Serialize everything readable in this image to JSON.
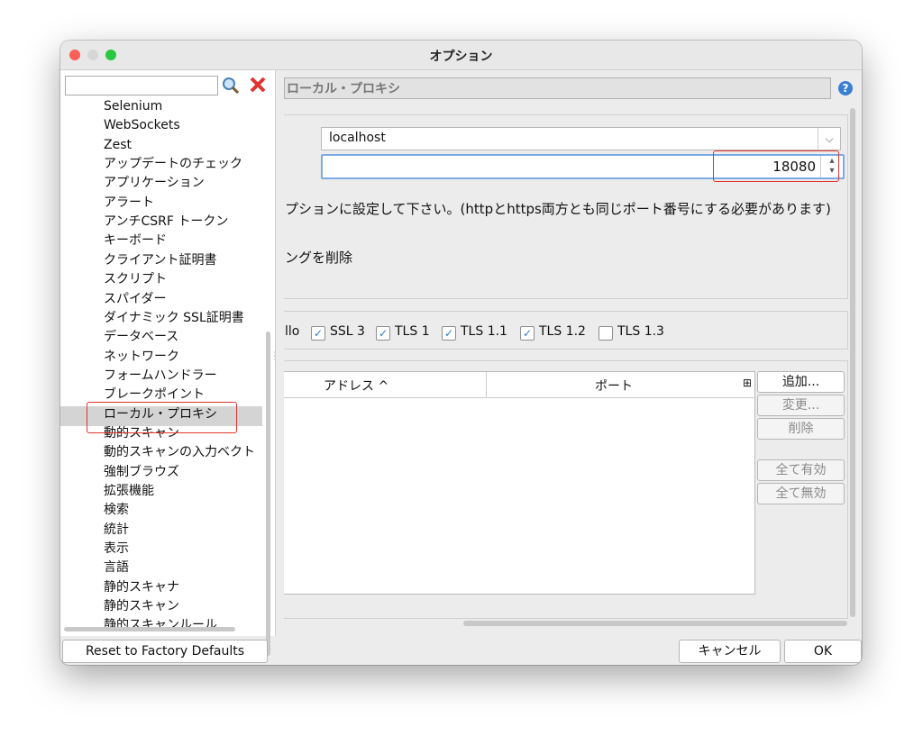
{
  "window": {
    "title": "オプション"
  },
  "tree": {
    "search_value": "",
    "items": [
      "Selenium",
      "WebSockets",
      "Zest",
      "アップデートのチェック",
      "アプリケーション",
      "アラート",
      "アンチCSRF トークン",
      "キーボード",
      "クライアント証明書",
      "スクリプト",
      "スパイダー",
      "ダイナミック SSL証明書",
      "データベース",
      "ネットワーク",
      "フォームハンドラー",
      "ブレークポイント",
      "ローカル・プロキシ",
      "動的スキャン",
      "動的スキャンの入力ベクト",
      "強制ブラウズ",
      "拡張機能",
      "検索",
      "統計",
      "表示",
      "言語",
      "静的スキャナ",
      "静的スキャン",
      "静的スキャンルール"
    ],
    "selected": "ローカル・プロキシ"
  },
  "panel": {
    "header": "ローカル・プロキシ"
  },
  "proxy": {
    "address": "localhost",
    "port": "18080",
    "note": "プションに設定して下さい。(httpとhttps両方とも同じポート番号にする必要があります)",
    "remove_label": "ングを削除"
  },
  "ssl": {
    "prefix": "llo",
    "options": [
      {
        "label": "SSL 3",
        "checked": true
      },
      {
        "label": "TLS 1",
        "checked": true
      },
      {
        "label": "TLS 1.1",
        "checked": true
      },
      {
        "label": "TLS 1.2",
        "checked": true
      },
      {
        "label": "TLS 1.3",
        "checked": false
      }
    ]
  },
  "table": {
    "columns": [
      "アドレス ^",
      "ポート"
    ],
    "buttons": {
      "add": "追加...",
      "modify": "変更...",
      "remove": "削除",
      "enable_all": "全て有効",
      "disable_all": "全て無効"
    }
  },
  "footer": {
    "reset": "Reset to Factory Defaults",
    "cancel": "キャンセル",
    "ok": "OK"
  },
  "colors": {
    "accent": "#2a7ad8",
    "highlight": "#e0332f",
    "close": "#fe5f57",
    "minimize": "#d6d6d6",
    "zoom": "#28c840"
  },
  "icons": {
    "search": "magnifier-icon",
    "clear": "red-x-icon",
    "help": "question-icon"
  }
}
